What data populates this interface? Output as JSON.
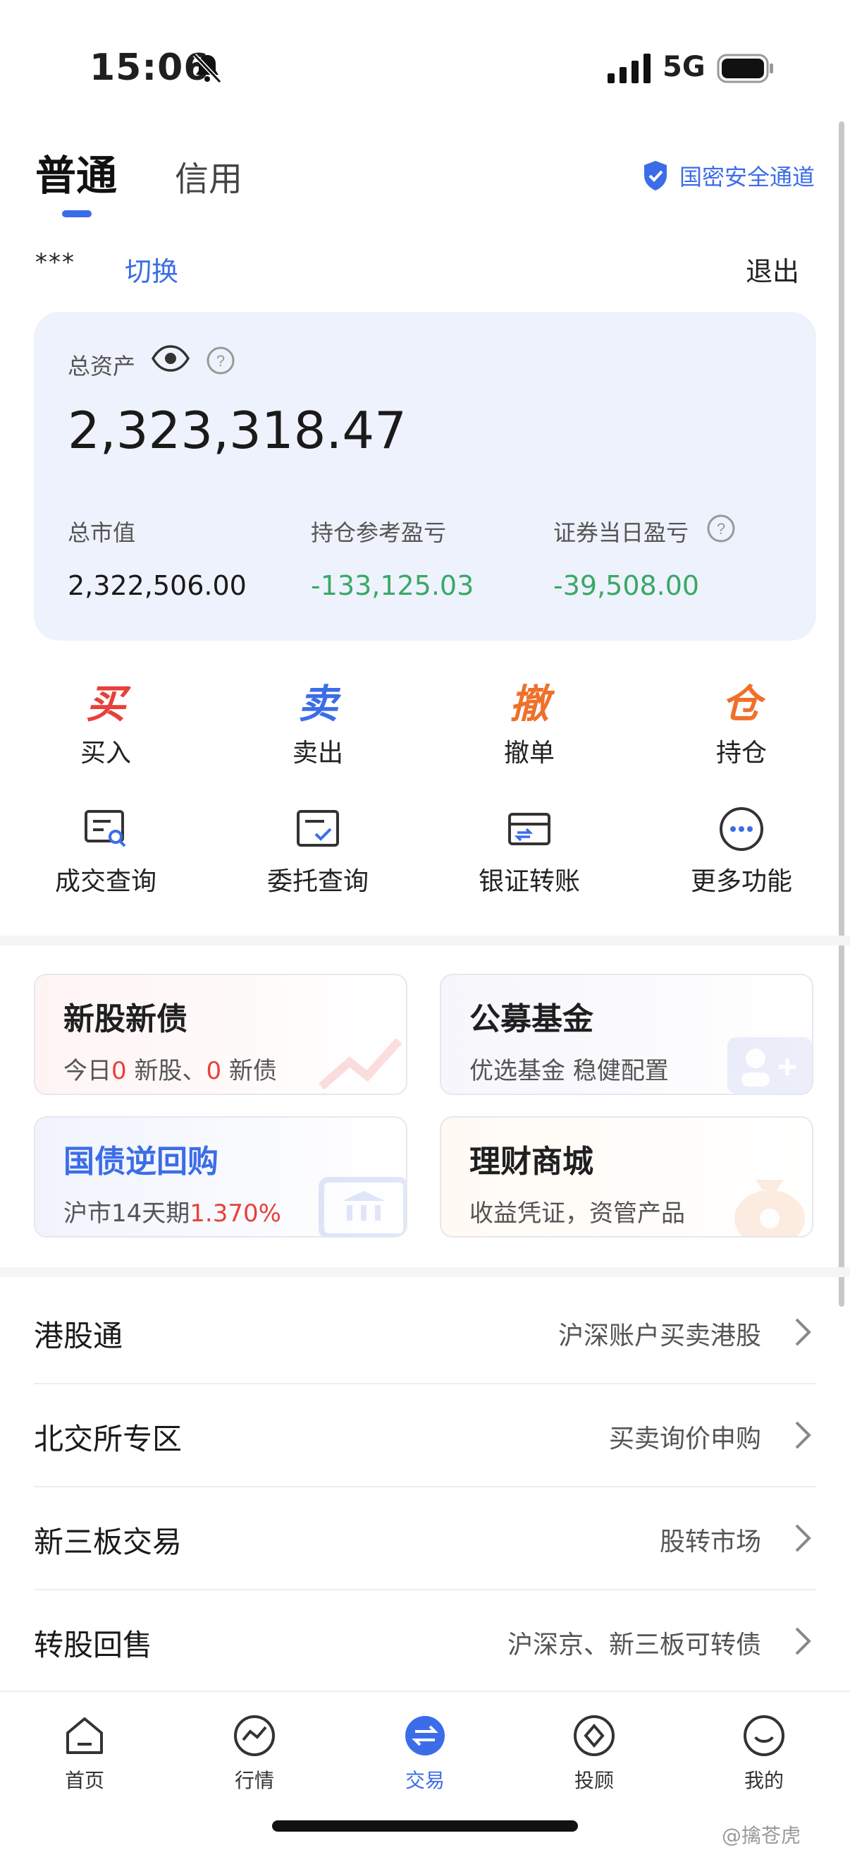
{
  "status_bar": {
    "time": "15:06",
    "network": "5G"
  },
  "header": {
    "tabs": [
      {
        "label": "普通"
      },
      {
        "label": "信用"
      }
    ],
    "secure_channel": "国密安全通道"
  },
  "account": {
    "masked": "***",
    "switch_label": "切换",
    "logout_label": "退出"
  },
  "assets": {
    "total_label": "总资产",
    "total_value": "2,323,318.47",
    "metrics": [
      {
        "label": "总市值",
        "value": "2,322,506.00",
        "color": "#1a1a1a"
      },
      {
        "label": "持仓参考盈亏",
        "value": "-133,125.03",
        "color": "#3aa867"
      },
      {
        "label": "证券当日盈亏",
        "value": "-39,508.00",
        "color": "#3aa867"
      }
    ]
  },
  "quick_actions": [
    {
      "glyph": "买",
      "label": "买入",
      "color": "#e8403a"
    },
    {
      "glyph": "卖",
      "label": "卖出",
      "color": "#3c6de8"
    },
    {
      "glyph": "撤",
      "label": "撤单",
      "color": "#f0702a"
    },
    {
      "glyph": "仓",
      "label": "持仓",
      "color": "#f0702a"
    }
  ],
  "tools": [
    {
      "label": "成交查询",
      "icon": "deal-query-icon"
    },
    {
      "label": "委托查询",
      "icon": "order-query-icon"
    },
    {
      "label": "银证转账",
      "icon": "bank-transfer-icon"
    },
    {
      "label": "更多功能",
      "icon": "more-icon"
    }
  ],
  "tiles": {
    "ipo": {
      "title": "新股新债",
      "sub_prefix": "今日",
      "stock_count": "0",
      "stock_text": " 新股、",
      "bond_count": "0",
      "bond_text": " 新债"
    },
    "fund": {
      "title": "公募基金",
      "sub": "优选基金 稳健配置"
    },
    "repo": {
      "title": "国债逆回购",
      "sub_prefix": "沪市14天期",
      "rate": "1.370%"
    },
    "mall": {
      "title": "理财商城",
      "sub": "收益凭证，资管产品"
    }
  },
  "list": [
    {
      "title": "港股通",
      "desc": "沪深账户买卖港股"
    },
    {
      "title": "北交所专区",
      "desc": "买卖询价申购"
    },
    {
      "title": "新三板交易",
      "desc": "股转市场"
    },
    {
      "title": "转股回售",
      "desc": "沪深京、新三板可转债"
    }
  ],
  "bottom_nav": [
    {
      "label": "首页"
    },
    {
      "label": "行情"
    },
    {
      "label": "交易"
    },
    {
      "label": "投顾"
    },
    {
      "label": "我的"
    }
  ],
  "watermark": "@擒苍虎",
  "colors": {
    "accent": "#3c6de8",
    "loss": "#3aa867",
    "gain": "#e8403a",
    "orange": "#f0702a"
  }
}
